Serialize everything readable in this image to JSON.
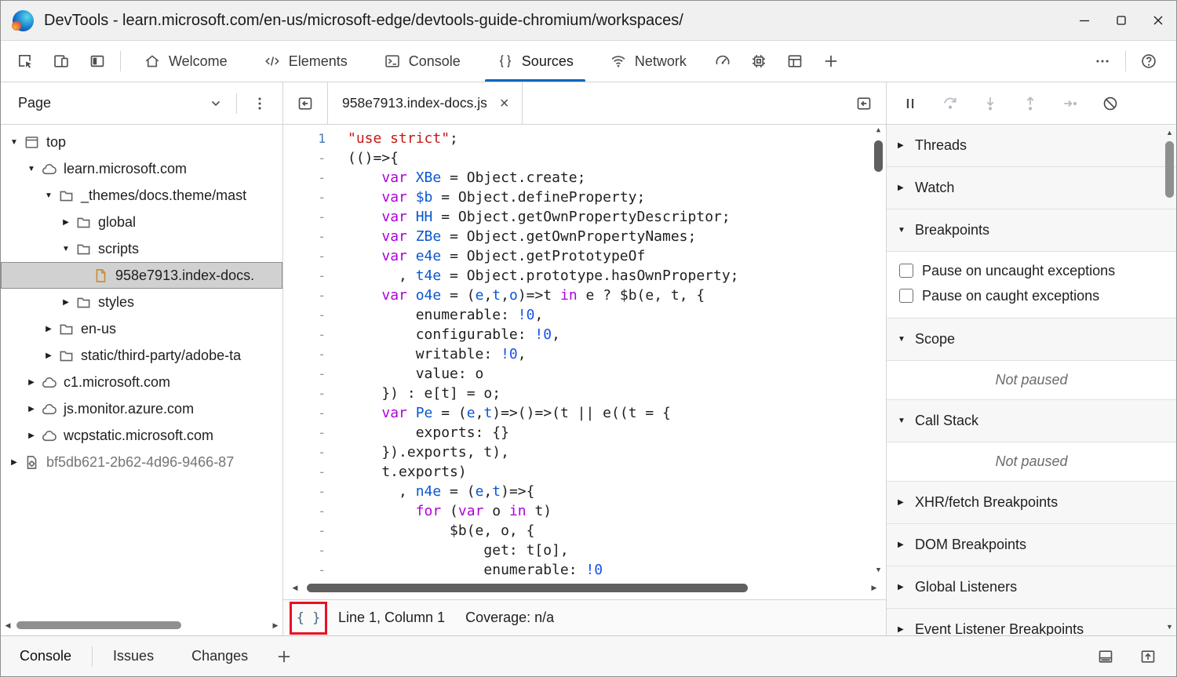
{
  "window": {
    "title": "DevTools - learn.microsoft.com/en-us/microsoft-edge/devtools-guide-chromium/workspaces/"
  },
  "colors": {
    "accent_blue": "#0067c0",
    "callout_red": "#e81123",
    "selection_gray": "#d1d1d1"
  },
  "main_toolbar": {
    "left_icons": [
      {
        "icon": "inspect",
        "name": "inspect-element"
      },
      {
        "icon": "device-emulation",
        "name": "device-emulation"
      },
      {
        "icon": "focus-panel",
        "name": "focus-mode"
      }
    ],
    "tabs": [
      {
        "label": "Welcome",
        "icon": "home",
        "active": false
      },
      {
        "label": "Elements",
        "icon": "elements",
        "active": false
      },
      {
        "label": "Console",
        "icon": "console",
        "active": false
      },
      {
        "label": "Sources",
        "icon": "sources",
        "active": true
      },
      {
        "label": "Network",
        "icon": "network",
        "active": false
      }
    ],
    "extra_icons": [
      {
        "icon": "performance",
        "name": "performance"
      },
      {
        "icon": "memory",
        "name": "memory"
      },
      {
        "icon": "application",
        "name": "application"
      },
      {
        "icon": "add-tab",
        "name": "more-tools"
      }
    ],
    "right_icons": [
      {
        "icon": "more",
        "name": "customize-devtools"
      },
      {
        "icon": "help",
        "name": "help"
      }
    ]
  },
  "navigator": {
    "dropdown_label": "Page",
    "tree": [
      {
        "label": "top",
        "icon": "frame",
        "state": "expanded",
        "indent": 0
      },
      {
        "label": "learn.microsoft.com",
        "icon": "cloud",
        "state": "expanded",
        "indent": 1
      },
      {
        "label": "_themes/docs.theme/mast",
        "icon": "folder",
        "state": "expanded",
        "indent": 2
      },
      {
        "label": "global",
        "icon": "folder",
        "state": "collapsed",
        "indent": 3
      },
      {
        "label": "scripts",
        "icon": "folder",
        "state": "expanded",
        "indent": 3
      },
      {
        "label": "958e7913.index-docs.",
        "icon": "file",
        "state": "leaf",
        "indent": 4,
        "selected": true
      },
      {
        "label": "styles",
        "icon": "folder",
        "state": "collapsed",
        "indent": 3
      },
      {
        "label": "en-us",
        "icon": "folder",
        "state": "collapsed",
        "indent": 2
      },
      {
        "label": "static/third-party/adobe-ta",
        "icon": "folder",
        "state": "collapsed",
        "indent": 2
      },
      {
        "label": "c1.microsoft.com",
        "icon": "cloud",
        "state": "collapsed",
        "indent": 1
      },
      {
        "label": "js.monitor.azure.com",
        "icon": "cloud",
        "state": "collapsed",
        "indent": 1
      },
      {
        "label": "wcpstatic.microsoft.com",
        "icon": "cloud",
        "state": "collapsed",
        "indent": 1
      },
      {
        "label": "bf5db621-2b62-4d96-9466-87",
        "icon": "extension",
        "state": "collapsed",
        "indent": 0,
        "dim": true
      }
    ]
  },
  "editor": {
    "tab_title": "958e7913.index-docs.js",
    "status": {
      "format_label": "{ }",
      "position": "Line 1, Column 1",
      "coverage": "Coverage: n/a"
    },
    "lines": [
      {
        "g": "1",
        "t": [
          [
            "s",
            "\"use strict\""
          ],
          [
            "p",
            ";"
          ]
        ]
      },
      {
        "g": "-",
        "t": [
          [
            "p",
            "(()=>{"
          ]
        ]
      },
      {
        "g": "-",
        "t": [
          [
            "p",
            "    "
          ],
          [
            "k",
            "var"
          ],
          [
            "p",
            " "
          ],
          [
            "v",
            "XBe"
          ],
          [
            "p",
            " = Object.create;"
          ]
        ]
      },
      {
        "g": "-",
        "t": [
          [
            "p",
            "    "
          ],
          [
            "k",
            "var"
          ],
          [
            "p",
            " "
          ],
          [
            "v",
            "$b"
          ],
          [
            "p",
            " = Object.defineProperty;"
          ]
        ]
      },
      {
        "g": "-",
        "t": [
          [
            "p",
            "    "
          ],
          [
            "k",
            "var"
          ],
          [
            "p",
            " "
          ],
          [
            "v",
            "HH"
          ],
          [
            "p",
            " = Object.getOwnPropertyDescriptor;"
          ]
        ]
      },
      {
        "g": "-",
        "t": [
          [
            "p",
            "    "
          ],
          [
            "k",
            "var"
          ],
          [
            "p",
            " "
          ],
          [
            "v",
            "ZBe"
          ],
          [
            "p",
            " = Object.getOwnPropertyNames;"
          ]
        ]
      },
      {
        "g": "-",
        "t": [
          [
            "p",
            "    "
          ],
          [
            "k",
            "var"
          ],
          [
            "p",
            " "
          ],
          [
            "v",
            "e4e"
          ],
          [
            "p",
            " = Object.getPrototypeOf"
          ]
        ]
      },
      {
        "g": "-",
        "t": [
          [
            "p",
            "      , "
          ],
          [
            "v",
            "t4e"
          ],
          [
            "p",
            " = Object.prototype.hasOwnProperty;"
          ]
        ]
      },
      {
        "g": "-",
        "t": [
          [
            "p",
            "    "
          ],
          [
            "k",
            "var"
          ],
          [
            "p",
            " "
          ],
          [
            "v",
            "o4e"
          ],
          [
            "p",
            " = ("
          ],
          [
            "v",
            "e"
          ],
          [
            "p",
            ","
          ],
          [
            "v",
            "t"
          ],
          [
            "p",
            ","
          ],
          [
            "v",
            "o"
          ],
          [
            "p",
            ")=>t "
          ],
          [
            "k",
            "in"
          ],
          [
            "p",
            " e ? $b(e, t, {"
          ]
        ]
      },
      {
        "g": "-",
        "t": [
          [
            "p",
            "        enumerable: "
          ],
          [
            "n",
            "!0"
          ],
          [
            "p",
            ","
          ]
        ]
      },
      {
        "g": "-",
        "t": [
          [
            "p",
            "        configurable: "
          ],
          [
            "n",
            "!0"
          ],
          [
            "p",
            ","
          ]
        ]
      },
      {
        "g": "-",
        "t": [
          [
            "p",
            "        writable: "
          ],
          [
            "n",
            "!0"
          ],
          [
            "p",
            ","
          ]
        ]
      },
      {
        "g": "-",
        "t": [
          [
            "p",
            "        value: o"
          ]
        ]
      },
      {
        "g": "-",
        "t": [
          [
            "p",
            "    }) : e[t] = o;"
          ]
        ]
      },
      {
        "g": "-",
        "t": [
          [
            "p",
            "    "
          ],
          [
            "k",
            "var"
          ],
          [
            "p",
            " "
          ],
          [
            "v",
            "Pe"
          ],
          [
            "p",
            " = ("
          ],
          [
            "v",
            "e"
          ],
          [
            "p",
            ","
          ],
          [
            "v",
            "t"
          ],
          [
            "p",
            ")=>()=>(t || e((t = {"
          ]
        ]
      },
      {
        "g": "-",
        "t": [
          [
            "p",
            "        exports: {}"
          ]
        ]
      },
      {
        "g": "-",
        "t": [
          [
            "p",
            "    }).exports, t),"
          ]
        ]
      },
      {
        "g": "-",
        "t": [
          [
            "p",
            "    t.exports)"
          ]
        ]
      },
      {
        "g": "-",
        "t": [
          [
            "p",
            "      , "
          ],
          [
            "v",
            "n4e"
          ],
          [
            "p",
            " = ("
          ],
          [
            "v",
            "e"
          ],
          [
            "p",
            ","
          ],
          [
            "v",
            "t"
          ],
          [
            "p",
            ")=>{"
          ]
        ]
      },
      {
        "g": "-",
        "t": [
          [
            "p",
            "        "
          ],
          [
            "k",
            "for"
          ],
          [
            "p",
            " ("
          ],
          [
            "k",
            "var"
          ],
          [
            "p",
            " o "
          ],
          [
            "k",
            "in"
          ],
          [
            "p",
            " t)"
          ]
        ]
      },
      {
        "g": "-",
        "t": [
          [
            "p",
            "            $b(e, o, {"
          ]
        ]
      },
      {
        "g": "-",
        "t": [
          [
            "p",
            "                get: t[o],"
          ]
        ]
      },
      {
        "g": "-",
        "t": [
          [
            "p",
            "                enumerable: "
          ],
          [
            "n",
            "!0"
          ]
        ]
      }
    ]
  },
  "debugger": {
    "toolbar": [
      {
        "icon": "pause",
        "name": "pause-script",
        "enabled": true
      },
      {
        "icon": "step-over",
        "name": "step-over",
        "enabled": false
      },
      {
        "icon": "step-into",
        "name": "step-into",
        "enabled": false
      },
      {
        "icon": "step-out",
        "name": "step-out",
        "enabled": false
      },
      {
        "icon": "step",
        "name": "step",
        "enabled": false
      },
      {
        "icon": "deactivate-breakpoints",
        "name": "deactivate-breakpoints",
        "enabled": true
      }
    ],
    "sections": [
      {
        "label": "Threads",
        "expanded": false
      },
      {
        "label": "Watch",
        "expanded": false
      },
      {
        "label": "Breakpoints",
        "expanded": true,
        "body": {
          "type": "checkboxes",
          "items": [
            {
              "label": "Pause on uncaught exceptions",
              "checked": false
            },
            {
              "label": "Pause on caught exceptions",
              "checked": false
            }
          ]
        }
      },
      {
        "label": "Scope",
        "expanded": true,
        "body": {
          "type": "note",
          "text": "Not paused"
        }
      },
      {
        "label": "Call Stack",
        "expanded": true,
        "body": {
          "type": "note",
          "text": "Not paused"
        }
      },
      {
        "label": "XHR/fetch Breakpoints",
        "expanded": false
      },
      {
        "label": "DOM Breakpoints",
        "expanded": false
      },
      {
        "label": "Global Listeners",
        "expanded": false
      },
      {
        "label": "Event Listener Breakpoints",
        "expanded": false
      }
    ]
  },
  "drawer": {
    "tabs": [
      {
        "label": "Console",
        "active": true
      },
      {
        "label": "Issues",
        "active": false
      },
      {
        "label": "Changes",
        "active": false
      }
    ]
  }
}
